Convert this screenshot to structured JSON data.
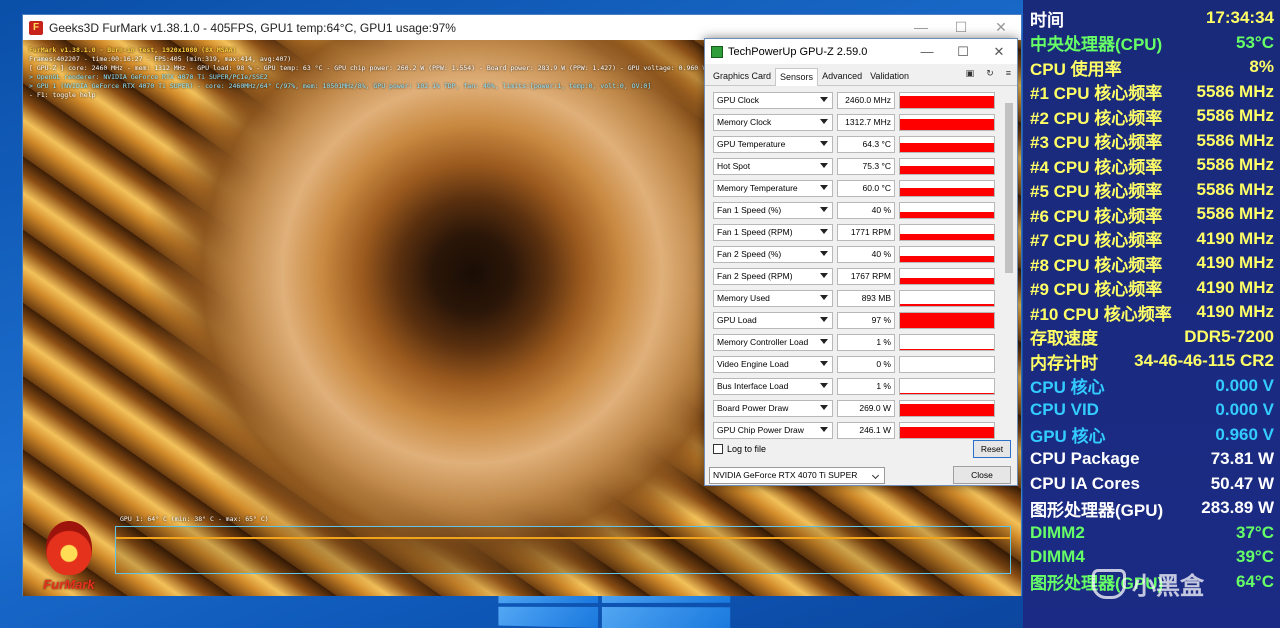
{
  "furmark": {
    "title": "Geeks3D FurMark v1.38.1.0 - 405FPS, GPU1 temp:64°C, GPU1 usage:97%",
    "controls": {
      "minimize": "—",
      "maximize": "☐",
      "close": "✕"
    },
    "osd": [
      "FurMark v1.38.1.0 - Burn-in test, 1920x1080 (8X MSAA)",
      "Frames:402207 - time:00:16:27 - FPS:405 (min:319, max:414, avg:407)",
      "[ GPU-Z ] core: 2460 MHz - mem: 1312 MHz - GPU load: 98 % - GPU temp: 63 °C - GPU chip power: 260.2 W (PPW: 1.554) - Board power: 283.9 W (PPW: 1.427) - GPU voltage: 0.960 V",
      "> OpenGL renderer: NVIDIA GeForce RTX 4070 Ti SUPER/PCIe/SSE2",
      "> GPU 1 (NVIDIA GeForce RTX 4070 Ti SUPER) - core: 2460MHz/64° C/97%, mem: 10501MHz/8%, GPU power: 102.1% TDP, fan: 40%, limits:[power:1, temp:0, volt:0, OV:0]",
      "- F1: toggle help"
    ],
    "graph_label": "GPU 1: 64° C (min: 38° C - max: 65° C)",
    "logo_text": "FurMark"
  },
  "gpuz": {
    "title": "TechPowerUp GPU-Z 2.59.0",
    "controls": {
      "minimize": "—",
      "maximize": "☐",
      "close": "✕"
    },
    "tabs": [
      "Graphics Card",
      "Sensors",
      "Advanced",
      "Validation"
    ],
    "active_tab": "Sensors",
    "tab_icons": [
      "camera-icon",
      "refresh-icon",
      "menu-icon"
    ],
    "sensors": [
      {
        "name": "GPU Clock",
        "value": "2460.0 MHz",
        "level": 0.75
      },
      {
        "name": "Memory Clock",
        "value": "1312.7 MHz",
        "level": 0.7
      },
      {
        "name": "GPU Temperature",
        "value": "64.3 °C",
        "level": 0.55
      },
      {
        "name": "Hot Spot",
        "value": "75.3 °C",
        "level": 0.5
      },
      {
        "name": "Memory Temperature",
        "value": "60.0 °C",
        "level": 0.5
      },
      {
        "name": "Fan 1 Speed (%)",
        "value": "40 %",
        "level": 0.4
      },
      {
        "name": "Fan 1 Speed (RPM)",
        "value": "1771 RPM",
        "level": 0.4
      },
      {
        "name": "Fan 2 Speed (%)",
        "value": "40 %",
        "level": 0.4
      },
      {
        "name": "Fan 2 Speed (RPM)",
        "value": "1767 RPM",
        "level": 0.4
      },
      {
        "name": "Memory Used",
        "value": "893 MB",
        "level": 0.08
      },
      {
        "name": "GPU Load",
        "value": "97 %",
        "level": 0.97
      },
      {
        "name": "Memory Controller Load",
        "value": "1 %",
        "level": 0.02
      },
      {
        "name": "Video Engine Load",
        "value": "0 %",
        "level": 0
      },
      {
        "name": "Bus Interface Load",
        "value": "1 %",
        "level": 0.02
      },
      {
        "name": "Board Power Draw",
        "value": "269.0 W",
        "level": 0.75
      },
      {
        "name": "GPU Chip Power Draw",
        "value": "246.1 W",
        "level": 0.7
      }
    ],
    "log_label": "Log to file",
    "reset_label": "Reset",
    "gpu_select": "NVIDIA GeForce RTX 4070 Ti SUPER",
    "close_label": "Close"
  },
  "sidebar": {
    "rows": [
      {
        "label": "时间",
        "value": "17:34:34",
        "label_color": "#ffffff",
        "value_color": "#ffff66"
      },
      {
        "label": "中央处理器(CPU)",
        "value": "53°C",
        "label_color": "#66ff66",
        "value_color": "#66ff66"
      },
      {
        "label": "CPU 使用率",
        "value": "8%",
        "label_color": "#ffff66",
        "value_color": "#ffff66"
      },
      {
        "label": "#1 CPU 核心频率",
        "value": "5586 MHz",
        "label_color": "#ffff66",
        "value_color": "#ffff66"
      },
      {
        "label": "#2 CPU 核心频率",
        "value": "5586 MHz",
        "label_color": "#ffff66",
        "value_color": "#ffff66"
      },
      {
        "label": "#3 CPU 核心频率",
        "value": "5586 MHz",
        "label_color": "#ffff66",
        "value_color": "#ffff66"
      },
      {
        "label": "#4 CPU 核心频率",
        "value": "5586 MHz",
        "label_color": "#ffff66",
        "value_color": "#ffff66"
      },
      {
        "label": "#5 CPU 核心频率",
        "value": "5586 MHz",
        "label_color": "#ffff66",
        "value_color": "#ffff66"
      },
      {
        "label": "#6 CPU 核心频率",
        "value": "5586 MHz",
        "label_color": "#ffff66",
        "value_color": "#ffff66"
      },
      {
        "label": "#7 CPU 核心频率",
        "value": "4190 MHz",
        "label_color": "#ffff66",
        "value_color": "#ffff66"
      },
      {
        "label": "#8 CPU 核心频率",
        "value": "4190 MHz",
        "label_color": "#ffff66",
        "value_color": "#ffff66"
      },
      {
        "label": "#9 CPU 核心频率",
        "value": "4190 MHz",
        "label_color": "#ffff66",
        "value_color": "#ffff66"
      },
      {
        "label": "#10 CPU 核心频率",
        "value": "4190 MHz",
        "label_color": "#ffff66",
        "value_color": "#ffff66"
      },
      {
        "label": "存取速度",
        "value": "DDR5-7200",
        "label_color": "#ffff66",
        "value_color": "#ffff66"
      },
      {
        "label": "内存计时",
        "value": "34-46-46-115 CR2",
        "label_color": "#ffff66",
        "value_color": "#ffff66"
      },
      {
        "label": "CPU 核心",
        "value": "0.000 V",
        "label_color": "#33ccff",
        "value_color": "#33ccff"
      },
      {
        "label": "CPU VID",
        "value": "0.000 V",
        "label_color": "#33ccff",
        "value_color": "#33ccff"
      },
      {
        "label": "GPU 核心",
        "value": "0.960 V",
        "label_color": "#33ccff",
        "value_color": "#33ccff"
      },
      {
        "label": "CPU Package",
        "value": "73.81 W",
        "label_color": "#ffffff",
        "value_color": "#ffffff"
      },
      {
        "label": "CPU IA Cores",
        "value": "50.47 W",
        "label_color": "#ffffff",
        "value_color": "#ffffff"
      },
      {
        "label": "图形处理器(GPU)",
        "value": "283.89 W",
        "label_color": "#ffffff",
        "value_color": "#ffffff"
      },
      {
        "label": "DIMM2",
        "value": "37°C",
        "label_color": "#66ff66",
        "value_color": "#66ff66"
      },
      {
        "label": "DIMM4",
        "value": "39°C",
        "label_color": "#66ff66",
        "value_color": "#66ff66"
      },
      {
        "label": "图形处理器(GPU)",
        "value": "64°C",
        "label_color": "#66ff66",
        "value_color": "#66ff66"
      }
    ]
  },
  "watermark": {
    "text": "小黑盒"
  }
}
